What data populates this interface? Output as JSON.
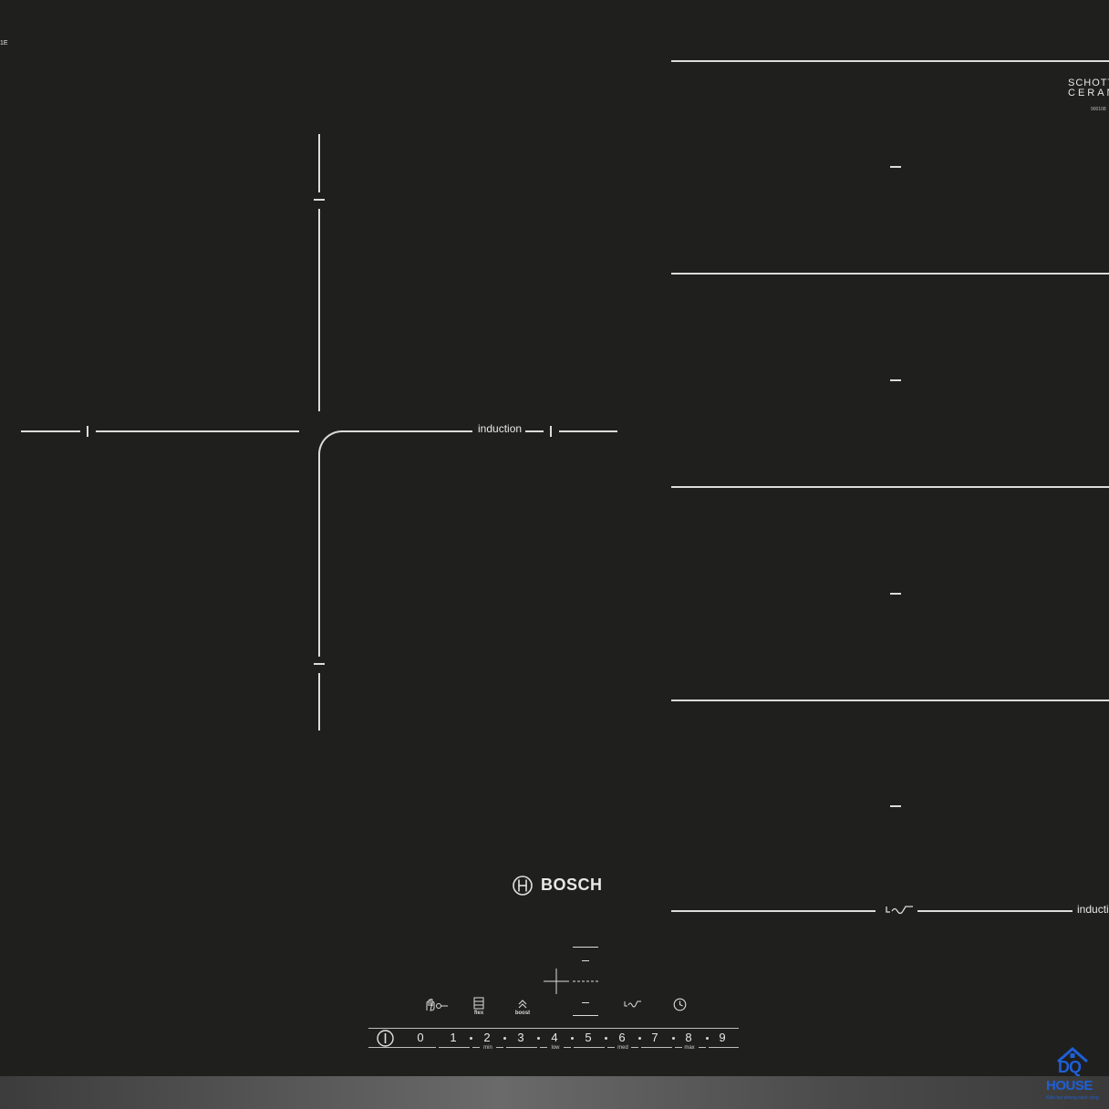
{
  "hob": {
    "corner_code": "1E",
    "left_zone_label": "induction",
    "brand": "BOSCH",
    "glass_brand_line1": "SCHOTT",
    "glass_brand_line2": "CERAN",
    "glass_code": "900108",
    "right_zone_label": "inductio"
  },
  "controls": {
    "power_icon": "power-icon",
    "numbers": [
      "0",
      "1",
      "2",
      "3",
      "4",
      "5",
      "6",
      "7",
      "8",
      "9"
    ],
    "sub_labels": {
      "min": "min",
      "low": "low",
      "med": "med",
      "max": "max"
    },
    "flex_label": "flex",
    "boost_label": "boost"
  },
  "watermark": {
    "logo_text": "DQ",
    "name": "HOUSE",
    "tagline": "Kiến tạo phong cách sống"
  },
  "colors": {
    "background": "#1f1f1e",
    "lines": "#dcdcdc",
    "watermark_blue": "#1f5fd6"
  }
}
